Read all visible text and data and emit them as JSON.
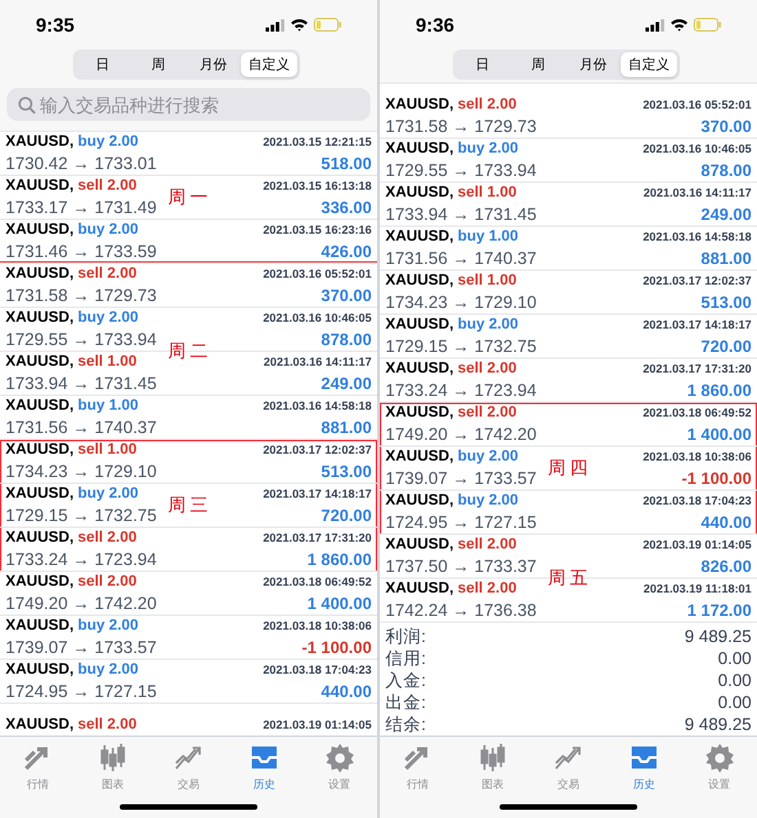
{
  "panels": [
    {
      "time": "9:35",
      "segments": [
        {
          "label": "日",
          "selected": false
        },
        {
          "label": "周",
          "selected": false
        },
        {
          "label": "月份",
          "selected": false
        },
        {
          "label": "自定义",
          "selected": true
        }
      ],
      "search": {
        "placeholder": "输入交易品种进行搜索"
      },
      "groups": [
        {
          "note": "周一",
          "kind": "rule",
          "rows": [
            {
              "symbol": "XAUUSD,",
              "kind": "buy",
              "order": "buy 2.00",
              "time": "2021.03.15 12:21:15",
              "prices": "1730.42 → 1733.01",
              "profit": "518.00",
              "loss": false
            },
            {
              "symbol": "XAUUSD,",
              "kind": "sell",
              "order": "sell 2.00",
              "time": "2021.03.15 16:13:18",
              "prices": "1733.17 → 1731.49",
              "profit": "336.00",
              "loss": false
            },
            {
              "symbol": "XAUUSD,",
              "kind": "buy",
              "order": "buy 2.00",
              "time": "2021.03.15 16:23:16",
              "prices": "1731.46 → 1733.59",
              "profit": "426.00",
              "loss": false
            }
          ]
        },
        {
          "note": "周二",
          "rows": [
            {
              "symbol": "XAUUSD,",
              "kind": "sell",
              "order": "sell 2.00",
              "time": "2021.03.16 05:52:01",
              "prices": "1731.58 → 1729.73",
              "profit": "370.00",
              "loss": false
            },
            {
              "symbol": "XAUUSD,",
              "kind": "buy",
              "order": "buy 2.00",
              "time": "2021.03.16 10:46:05",
              "prices": "1729.55 → 1733.94",
              "profit": "878.00",
              "loss": false
            },
            {
              "symbol": "XAUUSD,",
              "kind": "sell",
              "order": "sell 1.00",
              "time": "2021.03.16 14:11:17",
              "prices": "1733.94 → 1731.45",
              "profit": "249.00",
              "loss": false
            },
            {
              "symbol": "XAUUSD,",
              "kind": "buy",
              "order": "buy 1.00",
              "time": "2021.03.16 14:58:18",
              "prices": "1731.56 → 1740.37",
              "profit": "881.00",
              "loss": false
            }
          ]
        },
        {
          "note": "周三",
          "kind": "box",
          "rows": [
            {
              "symbol": "XAUUSD,",
              "kind": "sell",
              "order": "sell 1.00",
              "time": "2021.03.17 12:02:37",
              "prices": "1734.23 → 1729.10",
              "profit": "513.00",
              "loss": false
            },
            {
              "symbol": "XAUUSD,",
              "kind": "buy",
              "order": "buy 2.00",
              "time": "2021.03.17 14:18:17",
              "prices": "1729.15 → 1732.75",
              "profit": "720.00",
              "loss": false
            },
            {
              "symbol": "XAUUSD,",
              "kind": "sell",
              "order": "sell 2.00",
              "time": "2021.03.17 17:31:20",
              "prices": "1733.24 → 1723.94",
              "profit": "1 860.00",
              "loss": false
            }
          ]
        },
        {
          "rows": [
            {
              "symbol": "XAUUSD,",
              "kind": "sell",
              "order": "sell 2.00",
              "time": "2021.03.18 06:49:52",
              "prices": "1749.20 → 1742.20",
              "profit": "1 400.00",
              "loss": false
            },
            {
              "symbol": "XAUUSD,",
              "kind": "buy",
              "order": "buy 2.00",
              "time": "2021.03.18 10:38:06",
              "prices": "1739.07 → 1733.57",
              "profit": "-1 100.00",
              "loss": true
            },
            {
              "symbol": "XAUUSD,",
              "kind": "buy",
              "order": "buy 2.00",
              "time": "2021.03.18 17:04:23",
              "prices": "1724.95 → 1727.15",
              "profit": "440.00",
              "loss": false
            },
            {
              "symbol": "XAUUSD,",
              "kind": "sell",
              "order": "sell 2.00",
              "time": "2021.03.19 01:14:05"
            }
          ]
        }
      ],
      "tabs": [
        {
          "label": "行情",
          "selected": false
        },
        {
          "label": "图表",
          "selected": false
        },
        {
          "label": "交易",
          "selected": false
        },
        {
          "label": "历史",
          "selected": true
        },
        {
          "label": "设置",
          "selected": false
        }
      ]
    },
    {
      "time": "9:36",
      "segments": [
        {
          "label": "日",
          "selected": false
        },
        {
          "label": "周",
          "selected": false
        },
        {
          "label": "月份",
          "selected": false
        },
        {
          "label": "自定义",
          "selected": true
        }
      ],
      "groups": [
        {
          "rows": [
            {
              "symbol": "XAUUSD,",
              "kind": "sell",
              "order": "sell 2.00",
              "time": "2021.03.16 05:52:01",
              "prices": "1731.58 → 1729.73",
              "profit": "370.00",
              "loss": false
            },
            {
              "symbol": "XAUUSD,",
              "kind": "buy",
              "order": "buy 2.00",
              "time": "2021.03.16 10:46:05",
              "prices": "1729.55 → 1733.94",
              "profit": "878.00",
              "loss": false
            },
            {
              "symbol": "XAUUSD,",
              "kind": "sell",
              "order": "sell 1.00",
              "time": "2021.03.16 14:11:17",
              "prices": "1733.94 → 1731.45",
              "profit": "249.00",
              "loss": false
            },
            {
              "symbol": "XAUUSD,",
              "kind": "buy",
              "order": "buy 1.00",
              "time": "2021.03.16 14:58:18",
              "prices": "1731.56 → 1740.37",
              "profit": "881.00",
              "loss": false
            },
            {
              "symbol": "XAUUSD,",
              "kind": "sell",
              "order": "sell 1.00",
              "time": "2021.03.17 12:02:37",
              "prices": "1734.23 → 1729.10",
              "profit": "513.00",
              "loss": false
            },
            {
              "symbol": "XAUUSD,",
              "kind": "buy",
              "order": "buy 2.00",
              "time": "2021.03.17 14:18:17",
              "prices": "1729.15 → 1732.75",
              "profit": "720.00",
              "loss": false
            },
            {
              "symbol": "XAUUSD,",
              "kind": "sell",
              "order": "sell 2.00",
              "time": "2021.03.17 17:31:20",
              "prices": "1733.24 → 1723.94",
              "profit": "1 860.00",
              "loss": false
            }
          ]
        },
        {
          "note": "周四",
          "kind": "box",
          "rows": [
            {
              "symbol": "XAUUSD,",
              "kind": "sell",
              "order": "sell 2.00",
              "time": "2021.03.18 06:49:52",
              "prices": "1749.20 → 1742.20",
              "profit": "1 400.00",
              "loss": false
            },
            {
              "symbol": "XAUUSD,",
              "kind": "buy",
              "order": "buy 2.00",
              "time": "2021.03.18 10:38:06",
              "prices": "1739.07 → 1733.57",
              "profit": "-1 100.00",
              "loss": true
            },
            {
              "symbol": "XAUUSD,",
              "kind": "buy",
              "order": "buy 2.00",
              "time": "2021.03.18 17:04:23",
              "prices": "1724.95 → 1727.15",
              "profit": "440.00",
              "loss": false
            }
          ]
        },
        {
          "note": "周五",
          "rows": [
            {
              "symbol": "XAUUSD,",
              "kind": "sell",
              "order": "sell 2.00",
              "time": "2021.03.19 01:14:05",
              "prices": "1737.50 → 1733.37",
              "profit": "826.00",
              "loss": false
            },
            {
              "symbol": "XAUUSD,",
              "kind": "sell",
              "order": "sell 2.00",
              "time": "2021.03.19 11:18:01",
              "prices": "1742.24 → 1736.38",
              "profit": "1 172.00",
              "loss": false
            }
          ]
        }
      ],
      "summary": [
        {
          "label": "利润:",
          "value": "9 489.25"
        },
        {
          "label": "信用:",
          "value": "0.00"
        },
        {
          "label": "入金:",
          "value": "0.00"
        },
        {
          "label": "出金:",
          "value": "0.00"
        },
        {
          "label": "结余:",
          "value": "9 489.25"
        }
      ],
      "tabs": [
        {
          "label": "行情",
          "selected": false
        },
        {
          "label": "图表",
          "selected": false
        },
        {
          "label": "交易",
          "selected": false
        },
        {
          "label": "历史",
          "selected": true
        },
        {
          "label": "设置",
          "selected": false
        }
      ]
    }
  ]
}
